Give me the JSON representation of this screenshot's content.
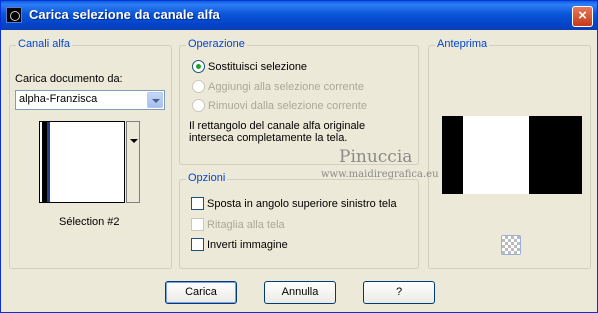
{
  "window": {
    "title": "Carica selezione da canale alfa",
    "close_label": "×"
  },
  "alpha_channels": {
    "group_label": "Canali alfa",
    "load_doc_label": "Carica documento da:",
    "document_value": "alpha-Franzisca",
    "selection_name": "Sélection #2"
  },
  "operation": {
    "group_label": "Operazione",
    "options": [
      {
        "label": "Sostituisci selezione",
        "selected": true,
        "enabled": true
      },
      {
        "label": "Aggiungi alla selezione corrente",
        "selected": false,
        "enabled": false
      },
      {
        "label": "Rimuovi dalla selezione corrente",
        "selected": false,
        "enabled": false
      }
    ],
    "info_line1": "Il rettangolo del canale alfa originale",
    "info_line2": "interseca completamente la tela."
  },
  "options": {
    "group_label": "Opzioni",
    "items": [
      {
        "label": "Sposta in angolo superiore sinistro tela",
        "checked": false,
        "enabled": true
      },
      {
        "label": "Ritaglia alla tela",
        "checked": false,
        "enabled": false
      },
      {
        "label": "Inverti immagine",
        "checked": false,
        "enabled": true
      }
    ]
  },
  "preview": {
    "group_label": "Anteprima"
  },
  "buttons": {
    "ok": "Carica",
    "cancel": "Annulla",
    "help": "?"
  },
  "watermark": {
    "name": "Pinuccia",
    "url": "www.maidiregrafica.eu"
  },
  "colors": {
    "title_bar": "#0a56d8",
    "group_label": "#0046d5",
    "dialog_bg": "#ece9d8",
    "radio_dot": "#21a121"
  }
}
